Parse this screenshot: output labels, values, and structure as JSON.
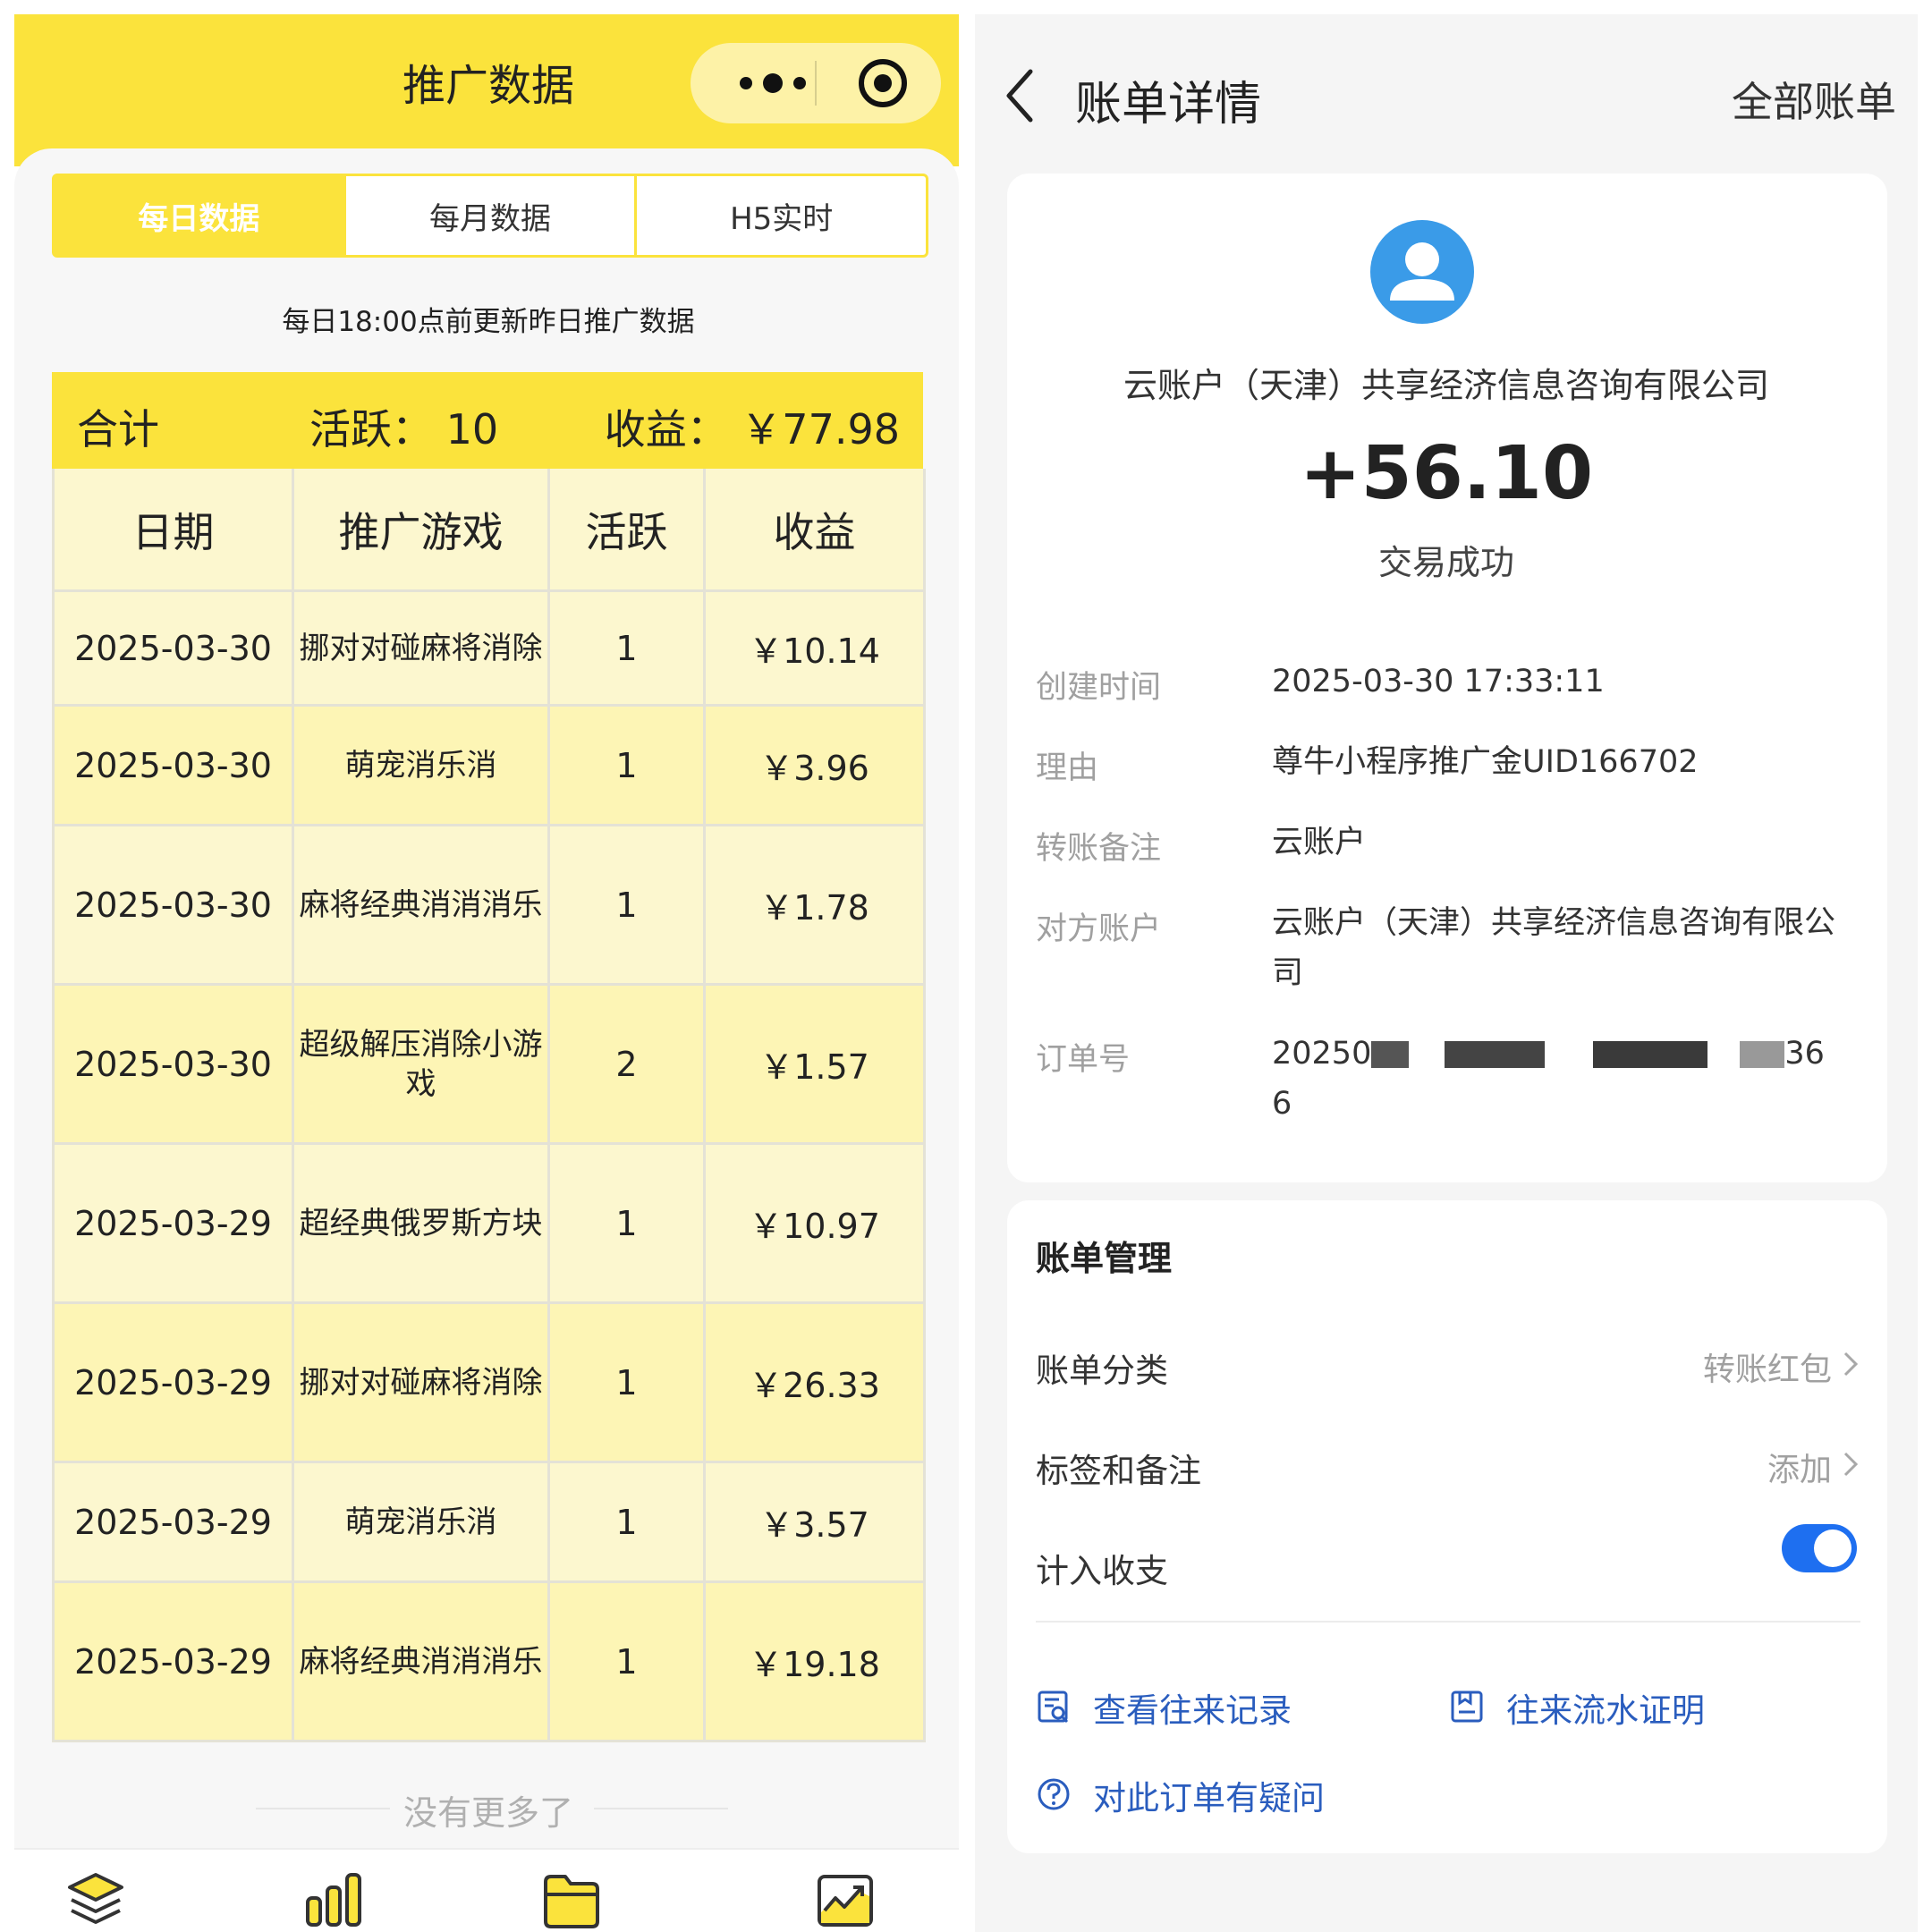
{
  "left": {
    "title": "推广数据",
    "tabs": [
      "每日数据",
      "每月数据",
      "H5实时"
    ],
    "note": "每日18:00点前更新昨日推广数据",
    "totals": {
      "label": "合计",
      "active": "活跃：  10",
      "revenue": "收益：  ￥77.98"
    },
    "columns": [
      "日期",
      "推广游戏",
      "活跃",
      "收益"
    ],
    "rows": [
      {
        "date": "2025-03-30",
        "game": "挪对对碰麻将消除",
        "active": "1",
        "revenue": "￥10.14"
      },
      {
        "date": "2025-03-30",
        "game": "萌宠消乐消",
        "active": "1",
        "revenue": "￥3.96"
      },
      {
        "date": "2025-03-30",
        "game": "麻将经典消消消乐",
        "active": "1",
        "revenue": "￥1.78"
      },
      {
        "date": "2025-03-30",
        "game": "超级解压消除小游戏",
        "active": "2",
        "revenue": "￥1.57"
      },
      {
        "date": "2025-03-29",
        "game": "超经典俄罗斯方块",
        "active": "1",
        "revenue": "￥10.97"
      },
      {
        "date": "2025-03-29",
        "game": "挪对对碰麻将消除",
        "active": "1",
        "revenue": "￥26.33"
      },
      {
        "date": "2025-03-29",
        "game": "萌宠消乐消",
        "active": "1",
        "revenue": "￥3.57"
      },
      {
        "date": "2025-03-29",
        "game": "麻将经典消消消乐",
        "active": "1",
        "revenue": "￥19.18"
      }
    ],
    "no_more": "没有更多了",
    "icons": [
      "layers-icon",
      "bar-chart-icon",
      "folder-icon",
      "trend-chart-icon"
    ],
    "accent": "#fbe33c"
  },
  "right": {
    "title": "账单详情",
    "all_bills": "全部账单",
    "company": "云账户（天津）共享经济信息咨询有限公司",
    "amount": "+56.10",
    "status": "交易成功",
    "details": [
      {
        "label": "创建时间",
        "value": "2025-03-30 17:33:11"
      },
      {
        "label": "理由",
        "value": "尊牛小程序推广金UID166702"
      },
      {
        "label": "转账备注",
        "value": "云账户"
      },
      {
        "label": "对方账户",
        "value": "云账户（天津）共享经济信息咨询有限公司"
      },
      {
        "label": "订单号",
        "value_prefix": "20250",
        "value_suffix": "36",
        "value_line2": "6"
      }
    ],
    "management": {
      "heading": "账单管理",
      "category_label": "账单分类",
      "category_value": "转账红包",
      "tags_label": "标签和备注",
      "tags_value": "添加",
      "include_label": "计入收支",
      "include_enabled": true
    },
    "links": {
      "history": "查看往来记录",
      "statement": "往来流水证明",
      "question": "对此订单有疑问"
    },
    "accent": "#1e6ff0",
    "link_color": "#2a5dbe"
  }
}
